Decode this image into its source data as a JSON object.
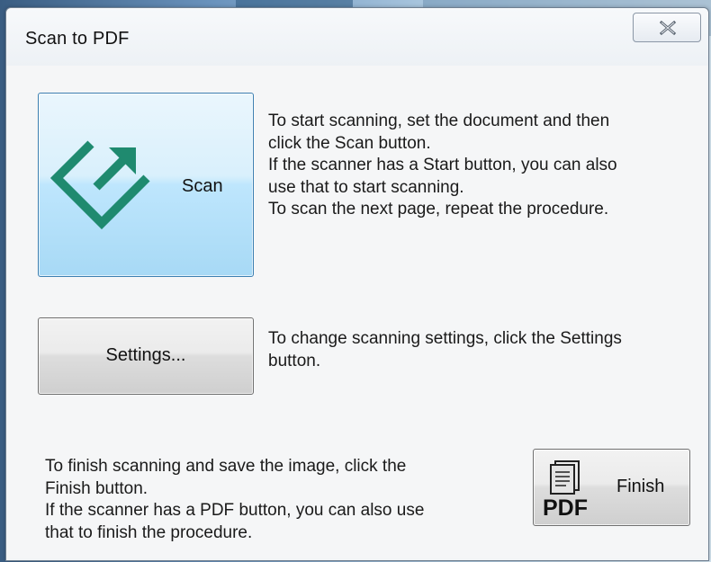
{
  "window": {
    "title": "Scan to PDF"
  },
  "scan": {
    "button_label": "Scan",
    "description": [
      "To start scanning, set the document and then",
      "click the Scan button.",
      "If the scanner has a Start button, you can also",
      "use that to start scanning.",
      "To scan the next page, repeat the procedure."
    ]
  },
  "settings": {
    "button_label": "Settings...",
    "description": [
      "To change scanning settings, click the Settings",
      "button."
    ]
  },
  "finish": {
    "button_label": "Finish",
    "icon_text": "PDF",
    "description": [
      "To finish scanning and save the image, click the",
      "Finish button.",
      "If the scanner has a PDF button, you can also use",
      "that to finish the procedure."
    ]
  },
  "icons": {
    "close": "close-icon",
    "scan": "scan-arrow-icon",
    "finish": "pdf-document-icon"
  },
  "colors": {
    "scan_icon": "#1f8a6f",
    "scan_button_border": "#3c7fb1",
    "scan_button_fill": "#bee6fd"
  }
}
